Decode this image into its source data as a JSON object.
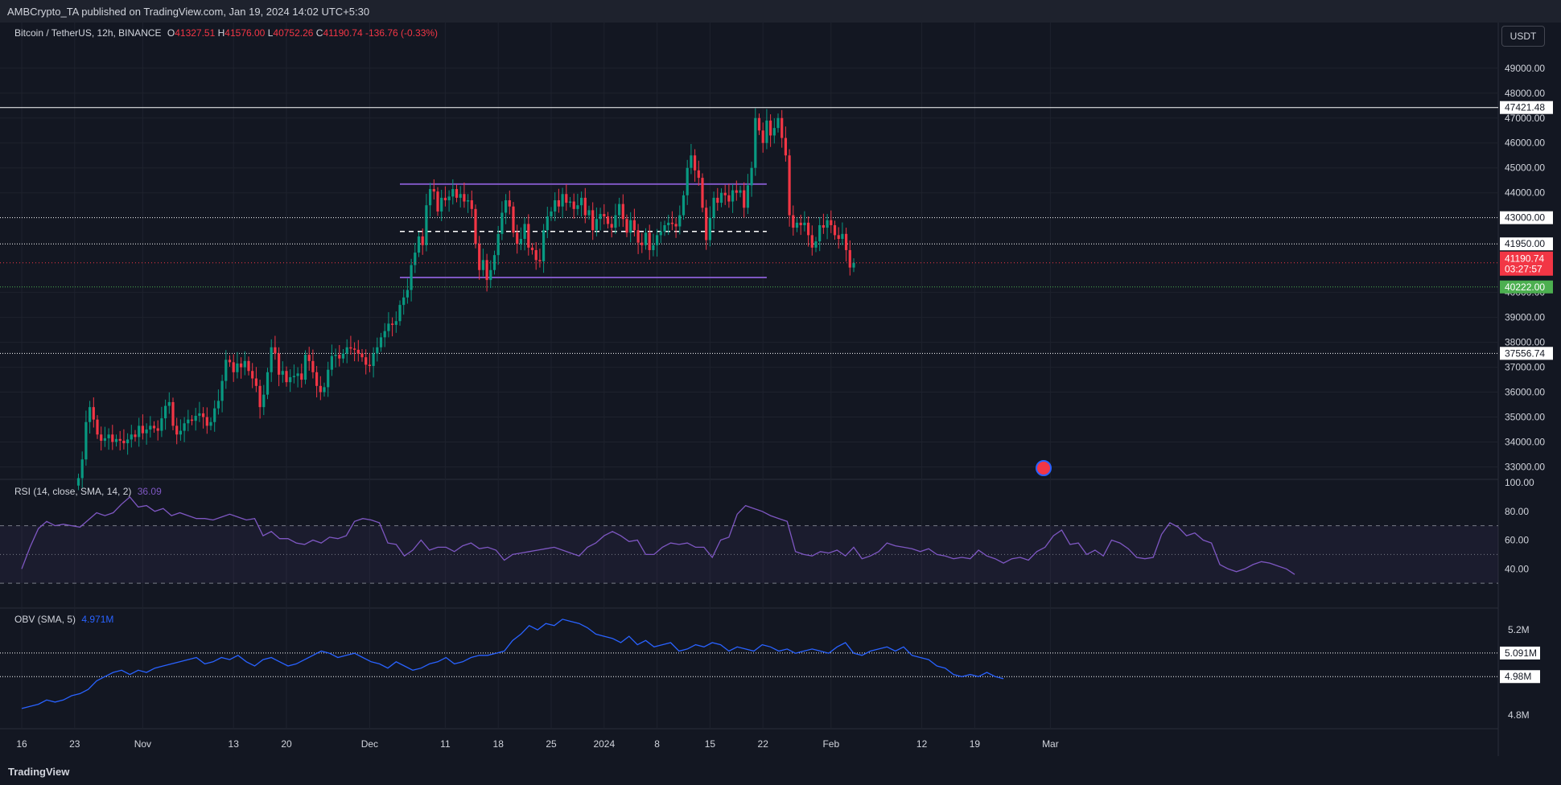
{
  "header": {
    "publish_text": "AMBCrypto_TA published on TradingView.com, Jan 19, 2024 14:02 UTC+5:30"
  },
  "main_legend": {
    "symbol": "Bitcoin / TetherUS, 12h, BINANCE",
    "o_label": "O",
    "o": "41327.51",
    "h_label": "H",
    "h": "41576.00",
    "l_label": "L",
    "l": "40752.26",
    "c_label": "C",
    "c": "41190.74",
    "change": "-136.76 (-0.33%)"
  },
  "currency_button": "USDT",
  "rsi_legend": {
    "name": "RSI (14, close, SMA, 14, 2)",
    "value": "36.09"
  },
  "obv_legend": {
    "name": "OBV (SMA, 5)",
    "value": "4.971M"
  },
  "footer": {
    "logo": "TradingView"
  },
  "colors": {
    "up": "#089981",
    "down": "#f23645",
    "range": "#7e57c2",
    "rsi": "#7e57c2",
    "obv": "#2962ff",
    "background": "#131722"
  },
  "chart_data": [
    {
      "type": "candlestick",
      "title": "Bitcoin / TetherUS, 12h, BINANCE",
      "x_ticks": [
        "16",
        "23",
        "Nov",
        "13",
        "20",
        "Dec",
        "11",
        "18",
        "25",
        "2024",
        "8",
        "15",
        "22",
        "Feb",
        "12",
        "19",
        "Mar"
      ],
      "y_ticks": [
        "33000.00",
        "34000.00",
        "35000.00",
        "36000.00",
        "37000.00",
        "38000.00",
        "39000.00",
        "40000.00",
        "44000.00",
        "45000.00",
        "46000.00",
        "47000.00",
        "48000.00",
        "49000.00"
      ],
      "ylim": [
        32500,
        49800
      ],
      "horizontal_levels": [
        {
          "label": "47421.48",
          "value": 47421.48,
          "style": "solid",
          "color": "#ffffff"
        },
        {
          "label": "43000.00",
          "value": 43000,
          "style": "dotted",
          "color": "#ffffff"
        },
        {
          "label": "41950.00",
          "value": 41950,
          "style": "dotted",
          "color": "#ffffff"
        },
        {
          "label": "37556.74",
          "value": 37556.74,
          "style": "dotted",
          "color": "#ffffff"
        },
        {
          "label": "40222.00",
          "value": 40222,
          "style": "dotted",
          "color": "#4caf50"
        }
      ],
      "current_price": {
        "label": "41190.74",
        "countdown": "03:27:57",
        "value": 41190.74
      },
      "range_box": {
        "high": 44350,
        "mid": 42450,
        "low": 40600,
        "start_day": 50,
        "end_day": 98.5
      },
      "close_series_start_day": 7.5,
      "close_series_step_days": 0.5,
      "close_series": [
        32550,
        33300,
        34800,
        35400,
        34900,
        34300,
        34050,
        34150,
        34300,
        34000,
        34120,
        34050,
        33950,
        34100,
        34300,
        34200,
        34650,
        34350,
        34500,
        34650,
        34550,
        34450,
        34950,
        35450,
        35600,
        34650,
        34300,
        34450,
        34750,
        34900,
        34850,
        35050,
        35150,
        35000,
        34650,
        34800,
        35350,
        35650,
        36450,
        37300,
        37200,
        36800,
        37150,
        37000,
        37250,
        36850,
        36550,
        36250,
        35400,
        35900,
        36800,
        37800,
        37550,
        36700,
        36850,
        36400,
        36600,
        36650,
        36750,
        36500,
        37500,
        37250,
        36800,
        36250,
        36000,
        36200,
        36900,
        37450,
        37500,
        37350,
        37550,
        37800,
        37750,
        37700,
        37550,
        37400,
        37100,
        37050,
        37550,
        37800,
        38200,
        38450,
        38750,
        38700,
        38850,
        39500,
        39800,
        40100,
        41100,
        41600,
        42250,
        41900,
        43500,
        44150,
        44050,
        43250,
        43800,
        43700,
        43850,
        44150,
        43800,
        43950,
        43650,
        43700,
        43350,
        41950,
        40900,
        41300,
        40500,
        40900,
        41500,
        42350,
        43200,
        43700,
        43450,
        42400,
        41950,
        42150,
        42750,
        41800,
        41700,
        41300,
        41250,
        42500,
        43050,
        43250,
        43700,
        43450,
        43950,
        43600,
        43650,
        43350,
        43500,
        43800,
        43100,
        43300,
        42500,
        42950,
        43150,
        43050,
        42750,
        42600,
        43100,
        43550,
        42950,
        42400,
        42900,
        42500,
        42000,
        41900,
        42400,
        41700,
        41900,
        42300,
        42450,
        42700,
        42800,
        42750,
        42650,
        43100,
        43900,
        45000,
        45500,
        44900,
        44600,
        43400,
        42100,
        43000,
        43800,
        43600,
        44000,
        43900,
        43650,
        44100,
        44000,
        44100,
        43400,
        44300,
        45000,
        47000,
        46500,
        46000,
        46900,
        46300,
        46600,
        47000,
        46200,
        45500,
        43100,
        42600,
        42800,
        42700,
        42800,
        42300,
        41800,
        42050,
        42700,
        42600,
        42900,
        42700,
        42300,
        42150,
        42350,
        41700,
        41000,
        41190.74
      ]
    },
    {
      "type": "line",
      "title": "RSI (14, close, SMA, 14, 2)",
      "y_ticks": [
        "100.00",
        "80.00",
        "60.00",
        "40.00"
      ],
      "ylim": [
        20,
        100
      ],
      "bands": [
        70,
        50,
        30
      ],
      "series_start_day": 0,
      "series_step_days": 1.1,
      "values": [
        40,
        55,
        68,
        73,
        70,
        71,
        70,
        69,
        74,
        79,
        77,
        79,
        85,
        90,
        83,
        84,
        80,
        82,
        77,
        79,
        77,
        75,
        75,
        74,
        76,
        78,
        76,
        74,
        75,
        63,
        66,
        61,
        61,
        58,
        57,
        60,
        58,
        62,
        61,
        63,
        73,
        75,
        74,
        72,
        58,
        57,
        49,
        53,
        60,
        53,
        55,
        55,
        52,
        56,
        58,
        54,
        55,
        53,
        46,
        50,
        51,
        52,
        53,
        54,
        55,
        53,
        51,
        49,
        55,
        58,
        63,
        66,
        63,
        59,
        60,
        50,
        50,
        55,
        58,
        57,
        58,
        55,
        55,
        48,
        60,
        62,
        78,
        84,
        82,
        80,
        77,
        75,
        73,
        52,
        50,
        49,
        52,
        51,
        53,
        49,
        55,
        47,
        49,
        52,
        58,
        56,
        55,
        54,
        52,
        54,
        50,
        49,
        47,
        48,
        47,
        53,
        49,
        47,
        44,
        47,
        48,
        46,
        52,
        55,
        63,
        67,
        57,
        58,
        50,
        53,
        49,
        60,
        58,
        54,
        48,
        47,
        48,
        64,
        72,
        69,
        63,
        65,
        60,
        58,
        43,
        40,
        38,
        40,
        43,
        45,
        44,
        42,
        40,
        36.09
      ]
    },
    {
      "type": "line",
      "title": "OBV (SMA, 5)",
      "y_ticks": [
        "5.2M",
        "4.8M"
      ],
      "ylim": [
        4.75,
        5.28
      ],
      "levels": [
        {
          "label": "5.091M",
          "value": 5.091
        },
        {
          "label": "4.98M",
          "value": 4.98
        }
      ],
      "series_start_day": 0,
      "series_step_days": 1.1,
      "values": [
        4.83,
        4.84,
        4.85,
        4.87,
        4.86,
        4.87,
        4.89,
        4.9,
        4.92,
        4.96,
        4.98,
        5,
        5.01,
        4.99,
        5.01,
        5,
        5.02,
        5.03,
        5.04,
        5.05,
        5.06,
        5.07,
        5.04,
        5.05,
        5.07,
        5.06,
        5.08,
        5.05,
        5.03,
        5.06,
        5.07,
        5.05,
        5.03,
        5.04,
        5.06,
        5.08,
        5.1,
        5.09,
        5.07,
        5.08,
        5.09,
        5.07,
        5.05,
        5.04,
        5.02,
        5.05,
        5.03,
        5.01,
        5.02,
        5.04,
        5.05,
        5.07,
        5.04,
        5.05,
        5.07,
        5.08,
        5.08,
        5.09,
        5.1,
        5.15,
        5.18,
        5.22,
        5.2,
        5.23,
        5.22,
        5.25,
        5.24,
        5.23,
        5.21,
        5.18,
        5.17,
        5.16,
        5.14,
        5.17,
        5.13,
        5.15,
        5.12,
        5.13,
        5.14,
        5.1,
        5.11,
        5.13,
        5.12,
        5.14,
        5.13,
        5.1,
        5.12,
        5.11,
        5.1,
        5.13,
        5.12,
        5.1,
        5.11,
        5.09,
        5.1,
        5.11,
        5.1,
        5.09,
        5.12,
        5.14,
        5.09,
        5.08,
        5.1,
        5.11,
        5.12,
        5.1,
        5.12,
        5.08,
        5.07,
        5.06,
        5.03,
        5.02,
        4.99,
        4.98,
        4.99,
        4.98,
        5,
        4.98,
        4.97
      ]
    }
  ]
}
